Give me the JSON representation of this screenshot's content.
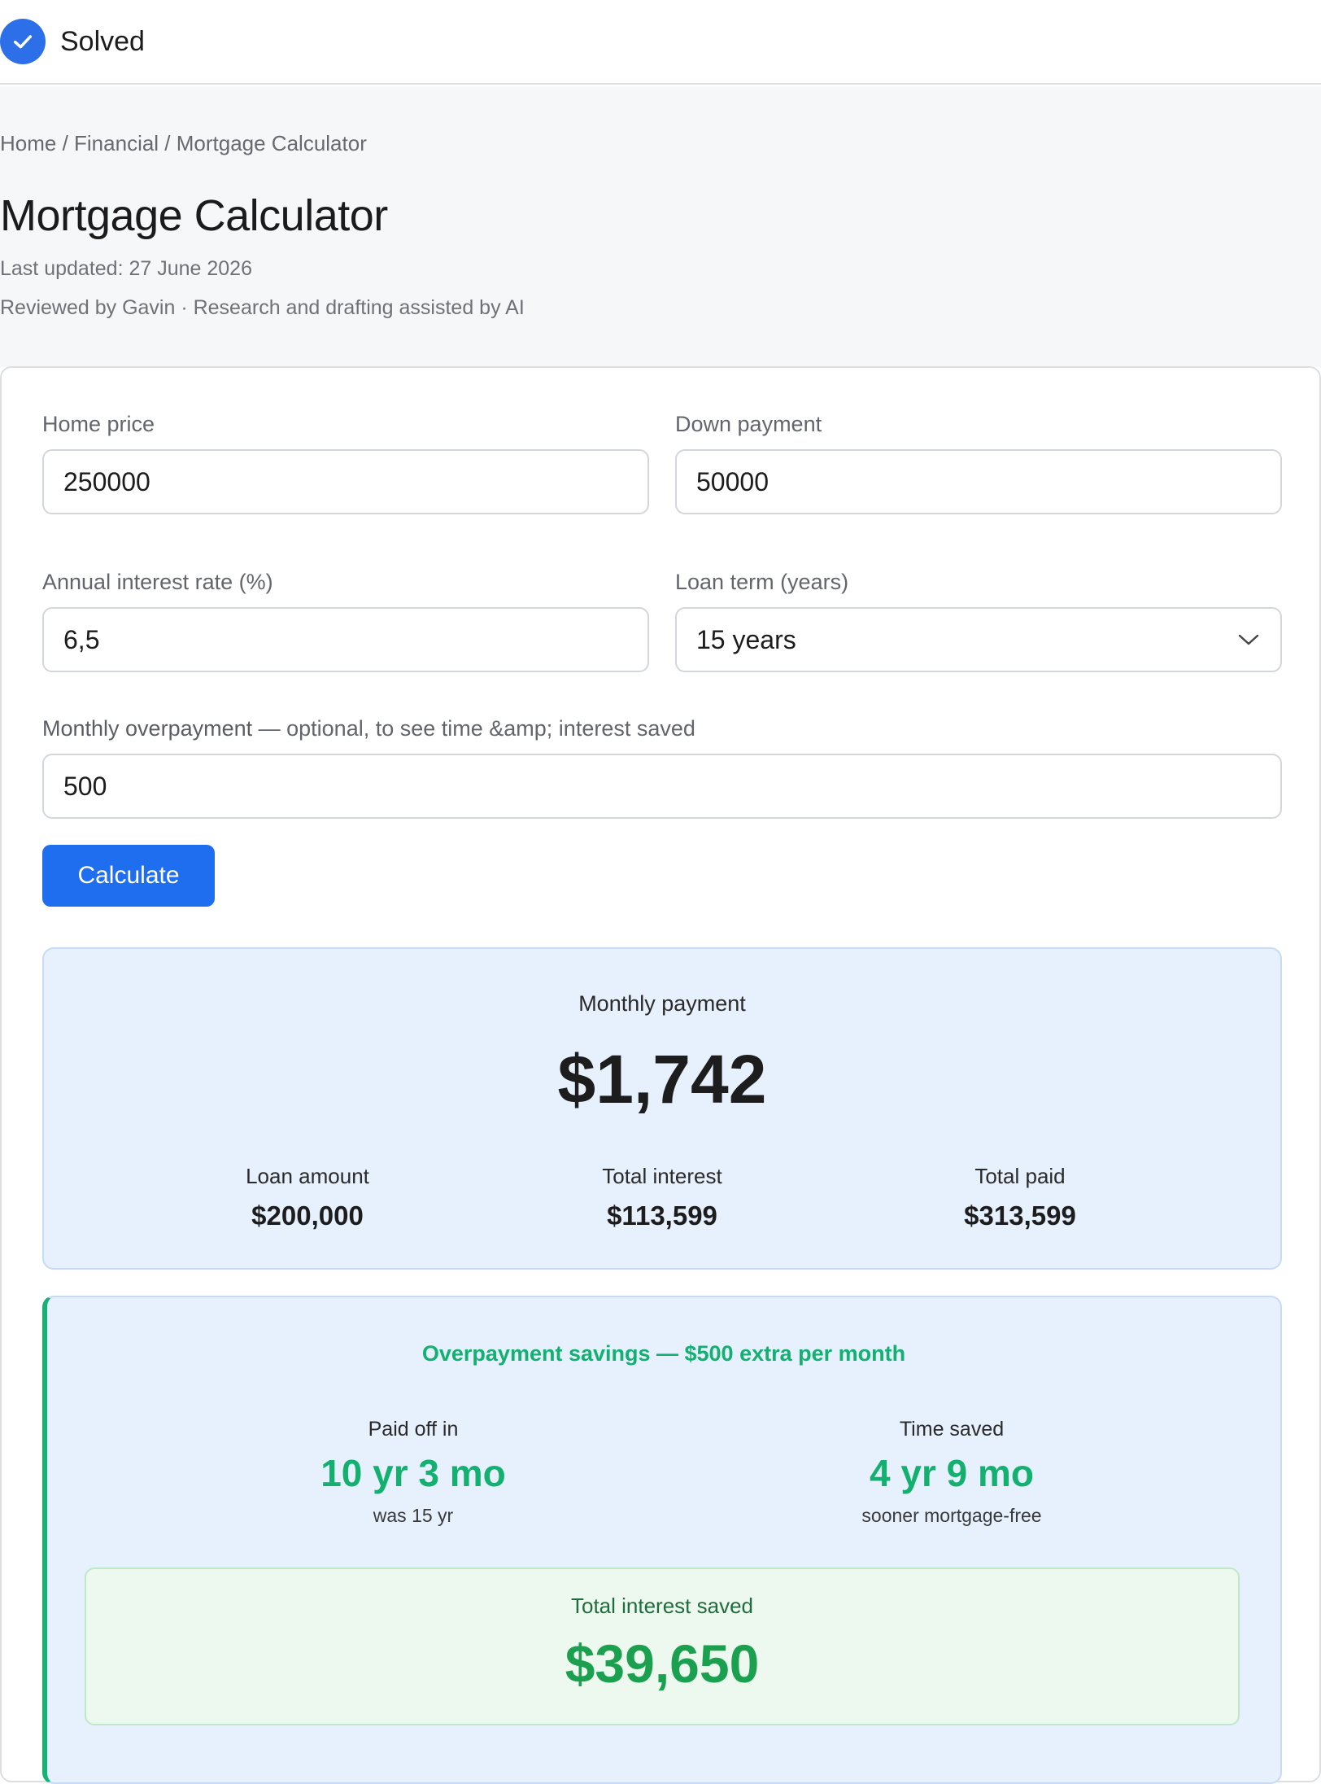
{
  "status": {
    "label": "Solved",
    "icon": "check-circle-icon",
    "color": "#2d6fe8"
  },
  "breadcrumb": "Home / Financial / Mortgage Calculator",
  "page": {
    "title": "Mortgage Calculator",
    "updated": "Last updated: 27 June 2026",
    "reviewed": "Reviewed by Gavin · Research and drafting assisted by AI"
  },
  "form": {
    "home_price": {
      "label": "Home price",
      "value": "250000"
    },
    "down_payment": {
      "label": "Down payment",
      "value": "50000"
    },
    "interest_rate": {
      "label": "Annual interest rate (%)",
      "value": "6,5"
    },
    "loan_term": {
      "label": "Loan term (years)",
      "value": "15 years"
    },
    "overpayment": {
      "label": "Monthly overpayment",
      "hint": " — optional, to see time &amp; interest saved",
      "value": "500"
    },
    "calculate_label": "Calculate"
  },
  "results": {
    "caption": "Monthly payment",
    "monthly_payment": "$1,742",
    "loan_amount": {
      "label": "Loan amount",
      "value": "$200,000"
    },
    "total_interest": {
      "label": "Total interest",
      "value": "$113,599"
    },
    "total_paid": {
      "label": "Total paid",
      "value": "$313,599"
    }
  },
  "savings": {
    "heading": "Overpayment savings — $500 extra per month",
    "paid_off": {
      "label": "Paid off in",
      "value": "10 yr 3 mo",
      "sub": "was 15 yr"
    },
    "time_saved": {
      "label": "Time saved",
      "value": "4 yr 9 mo",
      "sub": "sooner mortgage-free"
    },
    "interest_saved": {
      "label": "Total interest saved",
      "value": "$39,650"
    }
  },
  "colors": {
    "accent": "#1f6ef0",
    "savings_green": "#13b070",
    "results_bg": "#e7f0fd"
  }
}
